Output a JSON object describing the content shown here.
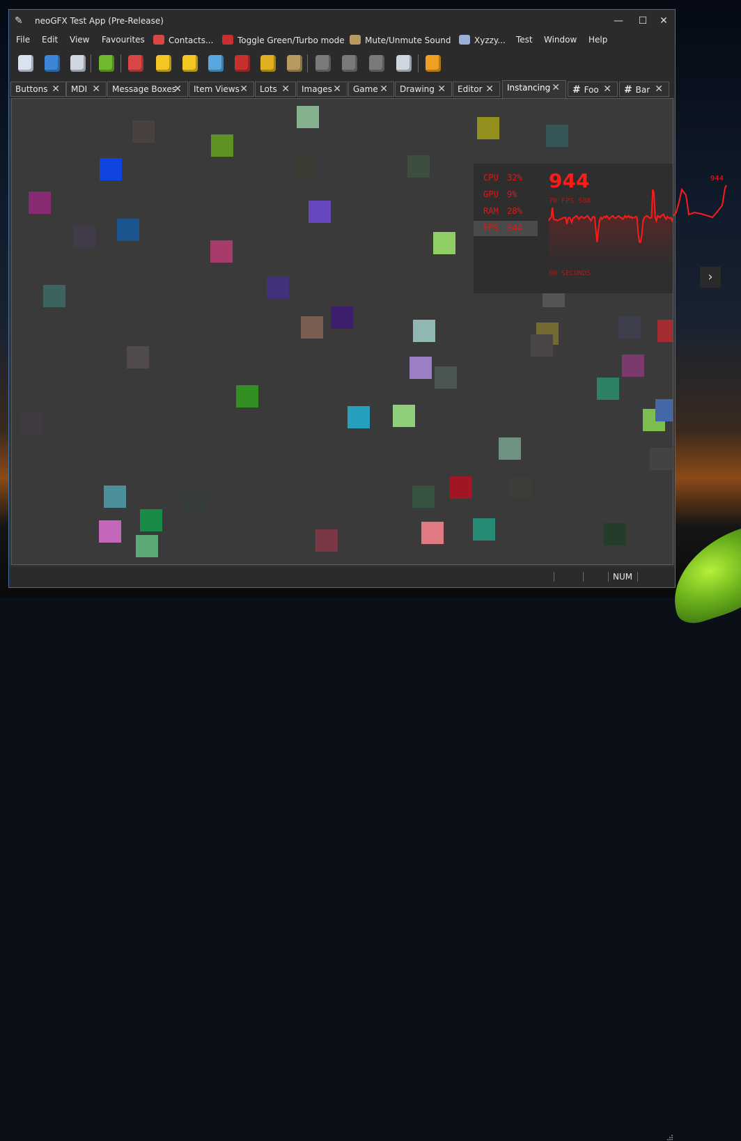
{
  "window": {
    "title": "neoGFX Test App (Pre-Release)"
  },
  "menu": [
    {
      "label": "File",
      "icon": ""
    },
    {
      "label": "Edit",
      "icon": ""
    },
    {
      "label": "View",
      "icon": ""
    },
    {
      "label": "Favourites",
      "icon": ""
    },
    {
      "label": "Contacts...",
      "icon": "people-icon"
    },
    {
      "label": "Toggle Green/Turbo mode",
      "icon": "turbo-gear-icon"
    },
    {
      "label": "Mute/Unmute Sound",
      "icon": "speaker-icon"
    },
    {
      "label": "Xyzzy...",
      "icon": "magic-wand-icon"
    },
    {
      "label": "Test",
      "icon": ""
    },
    {
      "label": "Window",
      "icon": ""
    },
    {
      "label": "Help",
      "icon": ""
    }
  ],
  "toolbar": [
    {
      "name": "new-document-icon",
      "color": "#d9e3f0"
    },
    {
      "name": "open-folder-icon",
      "color": "#3c86d8"
    },
    {
      "name": "save-icon",
      "color": "#cfd6e0"
    },
    {
      "name": "gamepad-icon",
      "color": "#6fba2c"
    },
    {
      "name": "contacts-icon",
      "color": "#d84646"
    },
    {
      "name": "add-favourite-icon",
      "color": "#f3c623"
    },
    {
      "name": "organise-favourites-icon",
      "color": "#f3c623"
    },
    {
      "name": "xyzzy-icon",
      "color": "#58a8e0"
    },
    {
      "name": "green-turbo-icon",
      "color": "#c83030"
    },
    {
      "name": "plugin-icon",
      "color": "#e0b020"
    },
    {
      "name": "sound-icon",
      "color": "#b89a60"
    },
    {
      "name": "cut-icon",
      "color": "#7a7a7a"
    },
    {
      "name": "copy-icon",
      "color": "#7a7a7a"
    },
    {
      "name": "paste-icon",
      "color": "#7a7a7a"
    },
    {
      "name": "paste-special-icon",
      "color": "#cfd6e0"
    },
    {
      "name": "settings-icon",
      "color": "#f0a020"
    }
  ],
  "tabs": [
    {
      "label": "Buttons",
      "hash": false
    },
    {
      "label": "MDI",
      "hash": false
    },
    {
      "label": "Message Boxes",
      "hash": false
    },
    {
      "label": "Item Views",
      "hash": false
    },
    {
      "label": "Lots",
      "hash": false
    },
    {
      "label": "Images",
      "hash": false
    },
    {
      "label": "Game",
      "hash": false
    },
    {
      "label": "Drawing",
      "hash": false
    },
    {
      "label": "Editor",
      "hash": false
    },
    {
      "label": "Instancing",
      "hash": false,
      "active": true
    },
    {
      "label": "Foo",
      "hash": true
    },
    {
      "label": "Bar",
      "hash": true
    }
  ],
  "perf": {
    "rows": [
      {
        "key": "CPU",
        "value": "32%"
      },
      {
        "key": "GPU",
        "value": "9%"
      },
      {
        "key": "RAM",
        "value": "28%"
      },
      {
        "key": "FPS",
        "value": "944",
        "selected": true
      }
    ],
    "fps_value": "944",
    "fps_range": "70 FPS 588",
    "window_label": "60 SECONDS",
    "graph_peak_label": "944",
    "fps_samples": [
      560,
      590,
      600,
      720,
      580,
      570,
      575,
      560,
      565,
      580,
      580,
      590,
      600,
      595,
      600,
      520,
      590,
      600,
      580,
      540,
      590,
      600,
      610,
      620,
      600,
      580,
      600,
      610,
      600,
      590,
      600,
      610,
      620,
      600,
      580,
      560,
      600,
      610,
      600,
      440,
      300,
      450,
      560,
      600,
      580,
      600,
      610,
      600,
      620,
      600,
      580,
      600,
      610,
      620,
      600,
      590,
      600,
      610,
      620,
      600,
      600,
      580,
      590,
      620,
      600,
      610,
      620,
      600,
      610,
      590,
      600,
      600,
      610,
      600,
      400,
      300,
      300,
      400,
      560,
      600,
      610,
      620,
      610,
      600,
      590,
      600,
      940,
      900,
      600,
      560,
      620,
      610,
      600,
      620,
      630,
      640,
      600,
      580,
      610,
      600,
      590,
      600,
      560,
      600,
      640,
      700,
      944
    ],
    "fps_max": 1000
  },
  "statusbar": {
    "num": "NUM"
  },
  "colors": {
    "accent": "#ff1a1a",
    "window_border": "#3f6ea8"
  }
}
